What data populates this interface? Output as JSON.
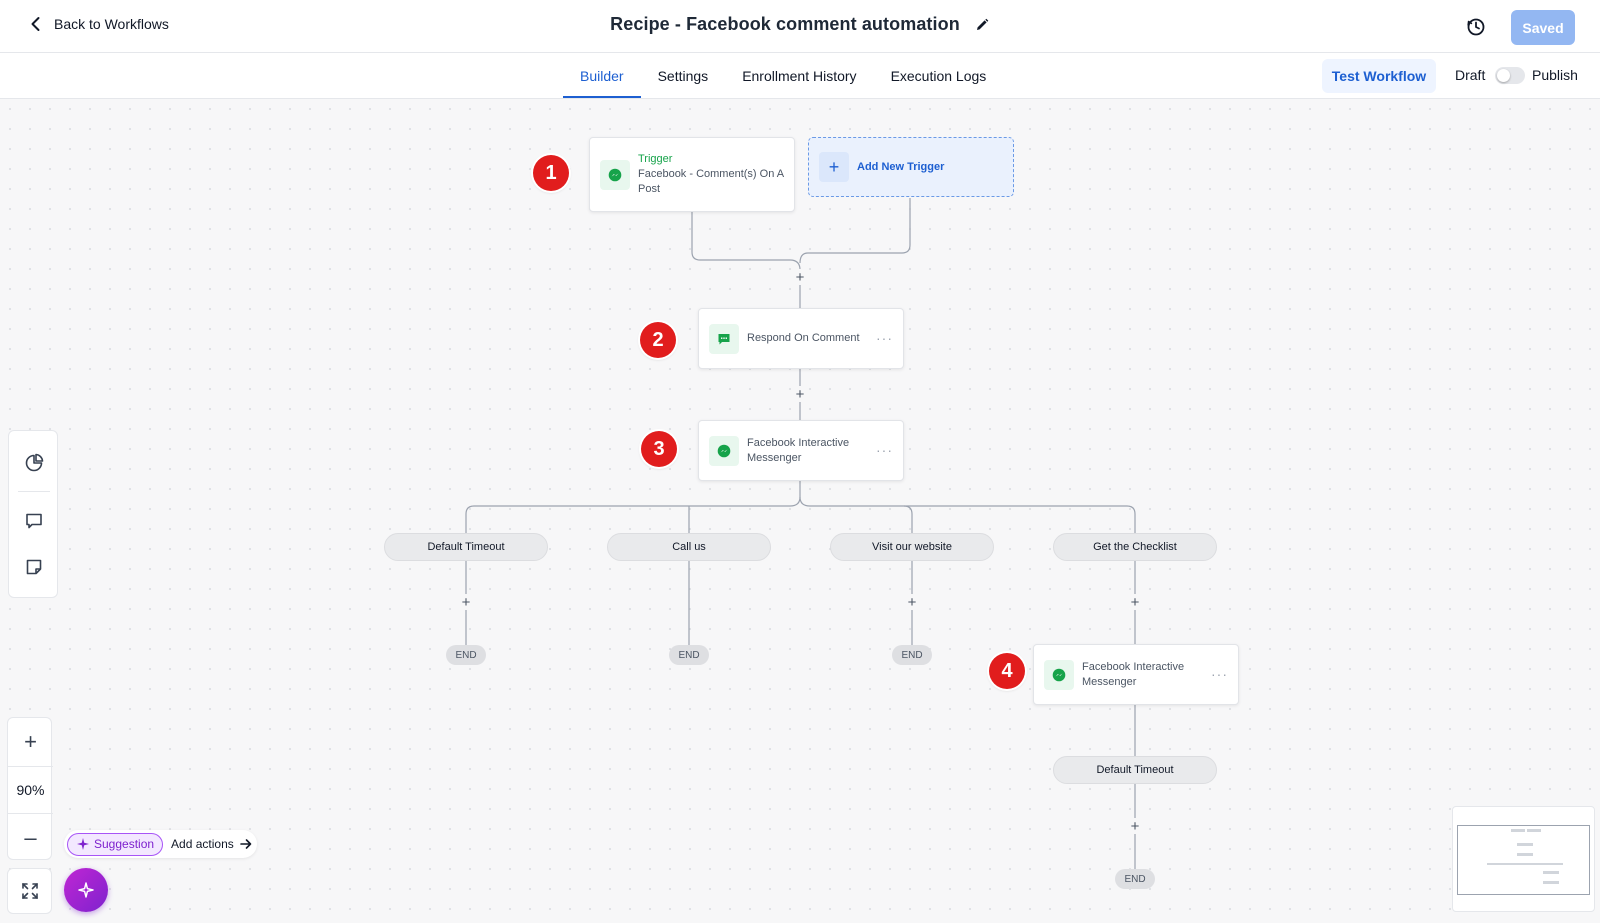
{
  "header": {
    "back_label": "Back to Workflows",
    "title": "Recipe - Facebook comment automation",
    "saved_label": "Saved"
  },
  "tabs": [
    {
      "label": "Builder",
      "active": true
    },
    {
      "label": "Settings",
      "active": false
    },
    {
      "label": "Enrollment History",
      "active": false
    },
    {
      "label": "Execution Logs",
      "active": false
    }
  ],
  "actions": {
    "test_label": "Test Workflow",
    "draft_label": "Draft",
    "publish_label": "Publish",
    "published": false
  },
  "workflow": {
    "trigger": {
      "kicker": "Trigger",
      "line1": "Facebook - Comment(s) On A",
      "line2": "Post",
      "step": "1"
    },
    "add_trigger_label": "Add New Trigger",
    "respond": {
      "label": "Respond On Comment",
      "step": "2"
    },
    "messenger1": {
      "line1": "Facebook Interactive",
      "line2": "Messenger",
      "step": "3"
    },
    "branches": [
      "Default Timeout",
      "Call us",
      "Visit our website",
      "Get the Checklist"
    ],
    "messenger2": {
      "line1": "Facebook Interactive",
      "line2": "Messenger",
      "step": "4"
    },
    "sub_branch": "Default Timeout",
    "end_label": "END",
    "menu_glyph": "···"
  },
  "zoom": {
    "plus": "+",
    "level": "90%",
    "minus": "–"
  },
  "suggestion": {
    "pill_label": "Suggestion",
    "add_actions_label": "Add actions"
  },
  "colors": {
    "accent": "#1d5fd1",
    "step_badge": "#e11d1d",
    "trigger_kicker": "#16a34a",
    "ai_purple": "#7e22ce"
  }
}
